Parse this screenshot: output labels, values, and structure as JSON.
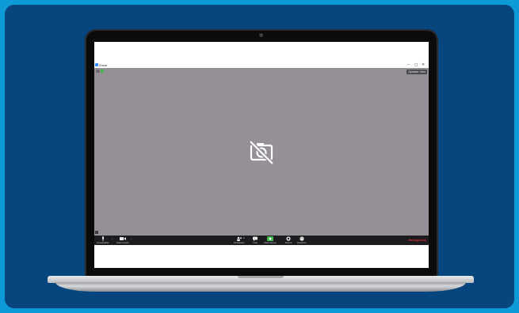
{
  "window": {
    "title": "Zoom",
    "controls": [
      "–",
      "◻",
      "✕"
    ]
  },
  "video": {
    "view_label": "Speaker View",
    "name_tag": ""
  },
  "toolbar": {
    "mute_label": "Unmute/Mute",
    "video_label": "Video Control",
    "participants_label": "Participants",
    "participants_count": "2",
    "chat_label": "Chat",
    "share_label": "Share Screen",
    "record_label": "Record",
    "reactions_label": "Reactions",
    "end_label": "Meeting ended"
  },
  "colors": {
    "background_outer": "#0e9ad7",
    "background_panel": "#06457e",
    "video_gray": "#958f97",
    "toolbar_dark": "#1c1c1f",
    "end_red": "#e02d2d",
    "share_green": "#3fb94a"
  }
}
